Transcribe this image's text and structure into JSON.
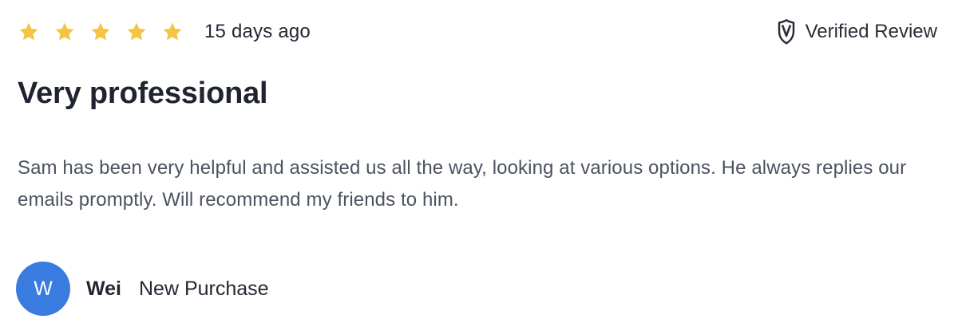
{
  "review": {
    "rating": 5,
    "rating_max": 5,
    "date": "15 days ago",
    "verified_label": "Verified Review",
    "title": "Very professional",
    "body": "Sam has been very helpful and assisted us all the way, looking at various options. He always replies our emails promptly. Will recommend my friends to him.",
    "reviewer": {
      "initial": "W",
      "name": "Wei",
      "purchase_type": "New Purchase"
    }
  },
  "icons": {
    "star": "star-icon",
    "verified": "verified-shield-icon"
  },
  "colors": {
    "star": "#f4c542",
    "avatar": "#3a7be0",
    "title": "#1f2430",
    "body": "#4b5260"
  }
}
